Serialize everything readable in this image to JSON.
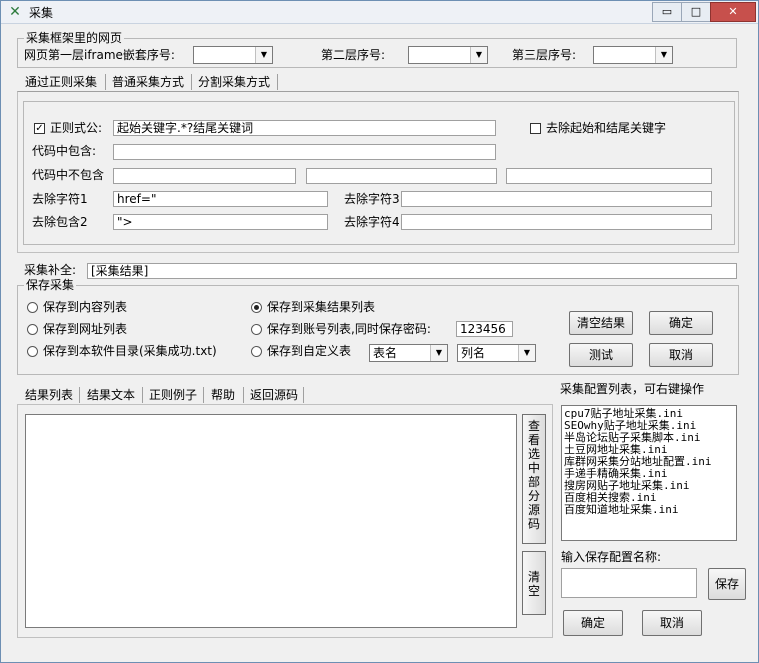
{
  "window": {
    "title": "采集",
    "controls": [
      "▭",
      "□",
      "✕"
    ]
  },
  "iframe_group": {
    "legend": "采集框架里的网页",
    "first_label": "网页第一层iframe嵌套序号:",
    "second_label": "第二层序号:",
    "third_label": "第三层序号:",
    "first_value": "",
    "second_value": "",
    "third_value": ""
  },
  "method_tabs": [
    "通过正则采集",
    "普通采集方式",
    "分割采集方式"
  ],
  "regex": {
    "checkbox_label": "正则式公:",
    "checked": true,
    "pattern": "起始关键字.*?结尾关键词",
    "strip_label": "去除起始和结尾关键字",
    "strip_checked": false,
    "contains_label": "代码中包含:",
    "contains_value": "",
    "not_contains_label": "代码中不包含",
    "not_contains_values": [
      "",
      "",
      ""
    ],
    "remove1_label": "去除字符1",
    "remove1_value": "href=\"",
    "remove3_label": "去除字符3",
    "remove3_value": "",
    "remove_contains2_label": "去除包含2",
    "remove_contains2_value": "\">",
    "remove4_label": "去除字符4",
    "remove4_value": ""
  },
  "supplement": {
    "label": "采集补全:",
    "value": "[采集结果]"
  },
  "save_group": {
    "legend": "保存采集",
    "options": {
      "content_list": "保存到内容列表",
      "url_list": "保存到网址列表",
      "software_dir": "保存到本软件目录(采集成功.txt)",
      "result_list": "保存到采集结果列表",
      "account_list": "保存到账号列表,同时保存密码:",
      "custom_table": "保存到自定义表"
    },
    "selected": "result_list",
    "password": "123456",
    "table_select": "表名",
    "column_select": "列名",
    "clear_button": "清空结果",
    "ok_button": "确定",
    "test_button": "测试",
    "cancel_button": "取消"
  },
  "result_tabs": [
    "结果列表",
    "结果文本",
    "正则例子",
    "帮助",
    "返回源码"
  ],
  "result_text": "",
  "side_buttons": {
    "view_source": "查看选中部分源码",
    "clear": "清空"
  },
  "config": {
    "title": "采集配置列表，可右键操作",
    "items": [
      "cpu7贴子地址采集.ini",
      "SEOwhy贴子地址采集.ini",
      "半岛论坛贴子采集脚本.ini",
      "土豆网地址采集.ini",
      "库群网采集分站地址配置.ini",
      "手递手精确采集.ini",
      "搜房网贴子地址采集.ini",
      "百度相关搜索.ini",
      "百度知道地址采集.ini"
    ],
    "name_label": "输入保存配置名称:",
    "name_value": "",
    "save_button": "保存",
    "ok_button": "确定",
    "cancel_button": "取消"
  },
  "colors": {
    "window_bg": "#f0f0f0",
    "title_bg": "#eef1f6",
    "close_btn": "#c7504c"
  }
}
